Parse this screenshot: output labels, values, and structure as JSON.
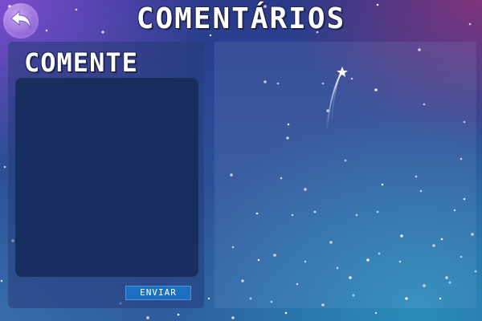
{
  "header": {
    "title": "COMENTÁRIOS",
    "back_icon": "back-arrow-icon"
  },
  "comment_form": {
    "heading": "COMENTE",
    "textarea_value": "",
    "send_label": "ENVIAR"
  },
  "comments_panel": {
    "decoration": "shooting-star-icon"
  },
  "colors": {
    "send_button": "#1d6fc0",
    "textarea_bg": "#172e5e",
    "title_text": "#ffffff"
  }
}
